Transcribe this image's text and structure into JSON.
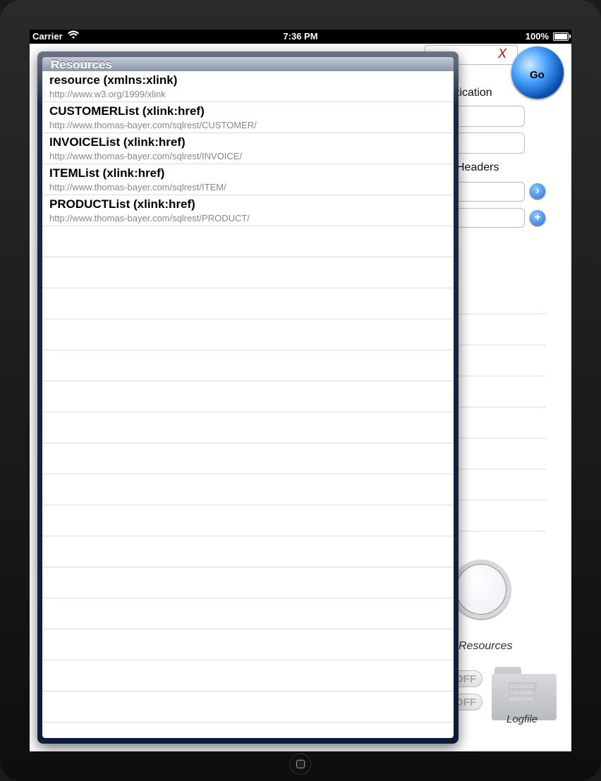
{
  "status_bar": {
    "carrier": "Carrier",
    "time": "7:36 PM",
    "battery": "100%"
  },
  "background": {
    "clear_label": "X",
    "go_label": "Go",
    "auth_label_partial": "tication",
    "headers_label_partial": "Headers",
    "resources_label": "Resources",
    "toggle_off_label": "OFF",
    "logfile_label": "Logfile",
    "logfile_binary": "01010010 10110101 01001101"
  },
  "popover": {
    "title": "Resources",
    "items": [
      {
        "title": "resource (xmlns:xlink)",
        "subtitle": "http://www.w3.org/1999/xlink"
      },
      {
        "title": "CUSTOMERList (xlink:href)",
        "subtitle": "http://www.thomas-bayer.com/sqlrest/CUSTOMER/"
      },
      {
        "title": "INVOICEList (xlink:href)",
        "subtitle": "http://www.thomas-bayer.com/sqlrest/INVOICE/"
      },
      {
        "title": "ITEMList (xlink:href)",
        "subtitle": "http://www.thomas-bayer.com/sqlrest/ITEM/"
      },
      {
        "title": "PRODUCTList (xlink:href)",
        "subtitle": "http://www.thomas-bayer.com/sqlrest/PRODUCT/"
      }
    ]
  }
}
